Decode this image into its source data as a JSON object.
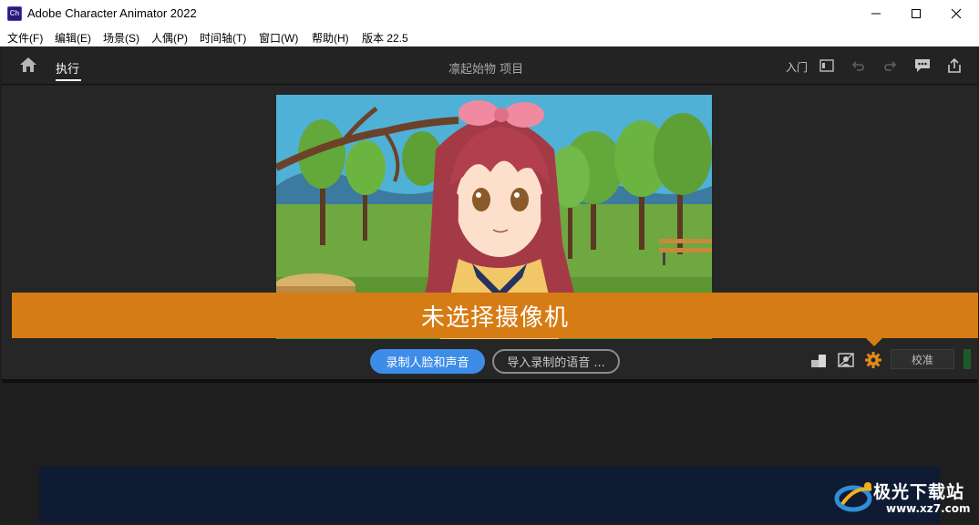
{
  "titlebar": {
    "app_icon_text": "Ch",
    "title": "Adobe Character Animator 2022",
    "controls": [
      "minimize-icon",
      "maximize-icon",
      "close-icon"
    ]
  },
  "menubar": {
    "items": [
      "文件(F)",
      "编辑(E)",
      "场景(S)",
      "人偶(P)",
      "时间轴(T)",
      "窗口(W)",
      "帮助(H)",
      "版本 22.5"
    ]
  },
  "header": {
    "mode_tab": "执行",
    "project_title": "凛起始物 项目",
    "learn_link": "入门",
    "icons": [
      "home-icon",
      "panel-layout-icon",
      "undo-icon",
      "redo-icon",
      "feedback-icon",
      "share-icon"
    ]
  },
  "scene": {
    "banner_text": "未选择摄像机",
    "record_button": "录制人脸和声音",
    "import_button": "导入录制的语音 ...",
    "calibrate_button": "校准",
    "tool_icons": [
      "arrange-icon",
      "camera-mirror-icon",
      "settings-gear-icon"
    ]
  },
  "watermark": {
    "line1": "极光下载站",
    "line2": "www.xz7.com"
  },
  "colors": {
    "banner": "#d67c14",
    "record_button": "#3d8de8",
    "background": "#1f1f1f"
  }
}
